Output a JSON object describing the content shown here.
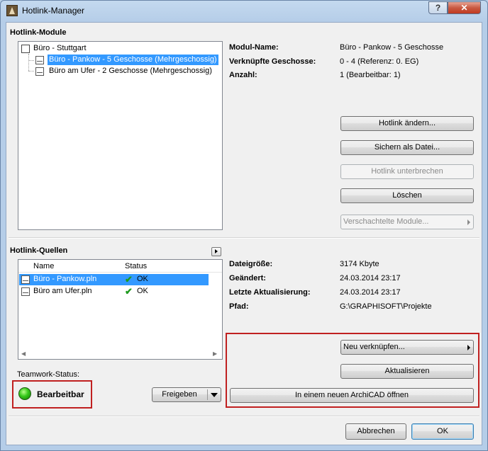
{
  "window": {
    "title": "Hotlink-Manager",
    "help_label": "?",
    "close_label": "✕"
  },
  "modules": {
    "header": "Hotlink-Module",
    "tree": [
      {
        "label": "Büro - Stuttgart"
      },
      {
        "label": "Büro - Pankow - 5 Geschosse (Mehrgeschossig)"
      },
      {
        "label": "Büro am Ufer - 2 Geschosse (Mehrgeschossig)"
      }
    ],
    "info": [
      {
        "label": "Modul-Name:",
        "value": "Büro - Pankow - 5 Geschosse"
      },
      {
        "label": "Verknüpfte Geschosse:",
        "value": "0 - 4 (Referenz: 0. EG)"
      },
      {
        "label": "Anzahl:",
        "value": "1 (Bearbeitbar: 1)"
      }
    ],
    "buttons": {
      "change": "Hotlink ändern...",
      "save": "Sichern als Datei...",
      "break": "Hotlink unterbrechen",
      "delete": "Löschen",
      "nested": "Verschachtelte Module..."
    }
  },
  "sources": {
    "header": "Hotlink-Quellen",
    "columns": [
      "Name",
      "Status"
    ],
    "rows": [
      {
        "name": "Büro - Pankow.pln",
        "status": "OK"
      },
      {
        "name": "Büro am Ufer.pln",
        "status": "OK"
      }
    ],
    "info": [
      {
        "label": "Dateigröße:",
        "value": "3174 Kbyte"
      },
      {
        "label": "Geändert:",
        "value": "24.03.2014 23:17"
      },
      {
        "label": "Letzte Aktualisierung:",
        "value": "24.03.2014 23:17"
      },
      {
        "label": "Pfad:",
        "value": "G:\\GRAPHISOFT\\Projekte"
      }
    ],
    "buttons": {
      "relink": "Neu verknüpfen...",
      "update": "Aktualisieren",
      "open": "In einem neuen ArchiCAD öffnen"
    }
  },
  "teamwork": {
    "label": "Teamwork-Status:",
    "status": "Bearbeitbar",
    "release": "Freigeben"
  },
  "footer": {
    "cancel": "Abbrechen",
    "ok": "OK"
  },
  "colors": {
    "selection": "#3399ff",
    "highlight_frame": "#c02020",
    "status_green": "#35c81a"
  }
}
